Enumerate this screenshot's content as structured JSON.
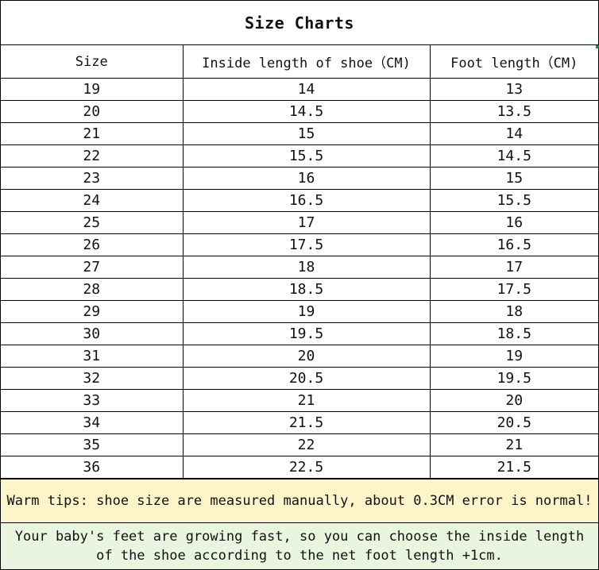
{
  "title": "Size Charts",
  "columns": [
    "Size",
    "Inside length of shoe（CM)",
    "Foot length（CM)"
  ],
  "rows": [
    [
      "19",
      "14",
      "13"
    ],
    [
      "20",
      "14.5",
      "13.5"
    ],
    [
      "21",
      "15",
      "14"
    ],
    [
      "22",
      "15.5",
      "14.5"
    ],
    [
      "23",
      "16",
      "15"
    ],
    [
      "24",
      "16.5",
      "15.5"
    ],
    [
      "25",
      "17",
      "16"
    ],
    [
      "26",
      "17.5",
      "16.5"
    ],
    [
      "27",
      "18",
      "17"
    ],
    [
      "28",
      "18.5",
      "17.5"
    ],
    [
      "29",
      "19",
      "18"
    ],
    [
      "30",
      "19.5",
      "18.5"
    ],
    [
      "31",
      "20",
      "19"
    ],
    [
      "32",
      "20.5",
      "19.5"
    ],
    [
      "33",
      "21",
      "20"
    ],
    [
      "34",
      "21.5",
      "20.5"
    ],
    [
      "35",
      "22",
      "21"
    ],
    [
      "36",
      "22.5",
      "21.5"
    ]
  ],
  "warm_tip": "Warm tips: shoe size are measured manually, about 0.3CM error is normal!",
  "note": "Your baby's feet are growing fast, so you can choose the inside length of the shoe according to the net foot length +1cm.",
  "colors": {
    "tip_background": "#fdf5c9",
    "note_background": "#e9f5de",
    "border": "#000000"
  }
}
